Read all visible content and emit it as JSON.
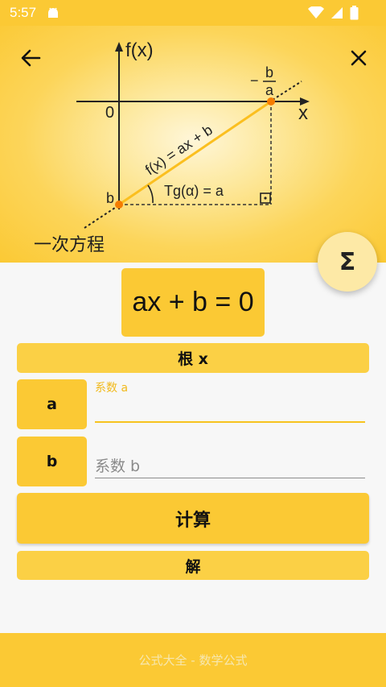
{
  "status_bar": {
    "time": "5:57",
    "icons": [
      "android-app-icon",
      "wifi-icon",
      "signal-icon",
      "battery-icon"
    ]
  },
  "header": {
    "title": "一次方程",
    "back_icon": "arrow-left-icon",
    "close_icon": "close-icon",
    "fab_symbol": "Σ",
    "diagram": {
      "y_axis_label": "f(x)",
      "x_axis_label": "x",
      "origin_label": "0",
      "intercept_label": "b",
      "root_label_sign": "−",
      "root_label_num": "b",
      "root_label_den": "a",
      "line_label": "f(x) = ax + b",
      "angle_label": "Tg(α) = a"
    }
  },
  "main": {
    "equation": "ax + b = 0",
    "result_label": "根 x",
    "fields": [
      {
        "var": "a",
        "float_label": "系数 a",
        "placeholder": "",
        "value": ""
      },
      {
        "var": "b",
        "float_label": "",
        "placeholder": "系数 b",
        "value": ""
      }
    ],
    "calc_button": "计算",
    "solve_label": "解"
  },
  "footer": {
    "text": "公式大全 - 数学公式"
  },
  "colors": {
    "accent": "#fbc934",
    "accent_light": "#fbd045",
    "point": "#f57c00",
    "line": "#fbbf1f"
  }
}
